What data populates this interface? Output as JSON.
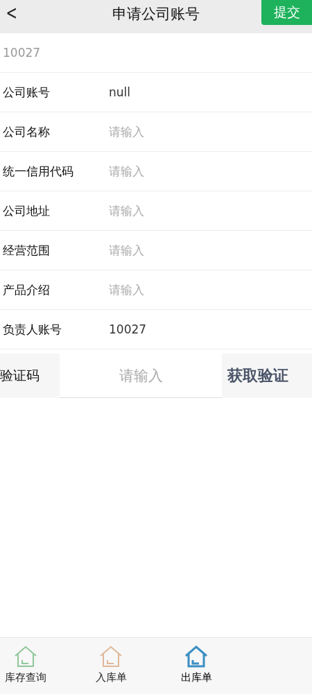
{
  "header": {
    "back": "<",
    "title": "申请公司账号",
    "submit": "提交"
  },
  "form_rows": [
    {
      "kind": "display",
      "value": "10027"
    },
    {
      "kind": "field",
      "label": "公司账号",
      "value": "null"
    },
    {
      "kind": "field",
      "label": "公司名称",
      "placeholder": "请输入"
    },
    {
      "kind": "field",
      "label": "统一信用代码",
      "placeholder": "请输入"
    },
    {
      "kind": "field",
      "label": "公司地址",
      "placeholder": "请输入"
    },
    {
      "kind": "field",
      "label": "经营范围",
      "placeholder": "请输入"
    },
    {
      "kind": "field",
      "label": "产品介绍",
      "placeholder": "请输入"
    },
    {
      "kind": "field",
      "label": "负责人账号",
      "value": "10027"
    }
  ],
  "verification": {
    "label": "验证码",
    "placeholder": "请输入",
    "button": "获取验证"
  },
  "bottom_nav": [
    {
      "label": "库存查询",
      "color": "#8fc79a",
      "selected": false
    },
    {
      "label": "入库单",
      "color": "#e0b898",
      "selected": false
    },
    {
      "label": "出库单",
      "color": "#3b8fc4",
      "selected": true
    }
  ]
}
